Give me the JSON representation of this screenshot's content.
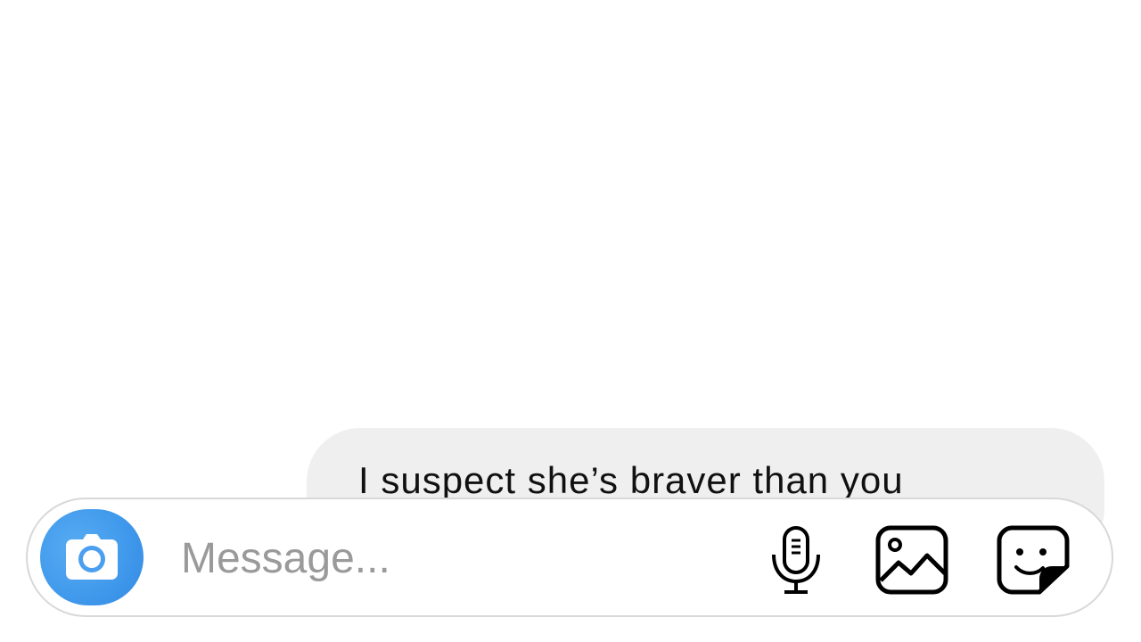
{
  "thread": {
    "messages": [
      {
        "text": "I suspect she’s braver than you",
        "direction": "incoming"
      }
    ]
  },
  "composer": {
    "placeholder": "Message...",
    "value": "",
    "camera_icon": "camera-icon",
    "mic_icon": "microphone-icon",
    "gallery_icon": "image-icon",
    "sticker_icon": "sticker-icon"
  },
  "colors": {
    "accent": "#3f98eb",
    "bubble_bg": "#efefef",
    "composer_border": "#d8d8d8",
    "placeholder_text": "#9a9a9a"
  }
}
